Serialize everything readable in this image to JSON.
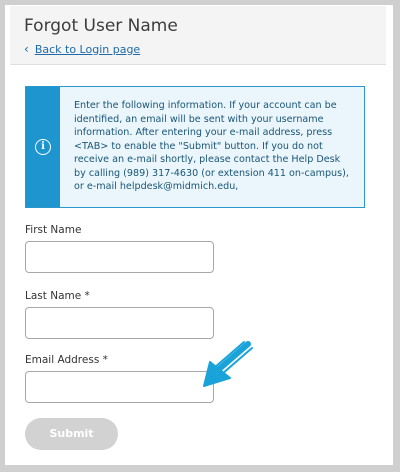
{
  "header": {
    "title": "Forgot User Name",
    "back_link": "Back to Login page"
  },
  "info": {
    "icon": "info-icon",
    "lines": [
      "Enter the following information. If your account can be",
      "identified, an email will be sent with your username",
      "information. After entering your e-mail address, press",
      "<TAB> to enable the \"Submit\" button. If you do not",
      "receive an e-mail shortly, please contact the Help Desk",
      "by calling (989) 317-4630 (or extension 411 on-campus),",
      "or e-mail helpdesk@midmich.edu,"
    ]
  },
  "form": {
    "first_name_label": "First Name",
    "last_name_label": "Last Name *",
    "email_label": "Email Address *",
    "first_name_value": "",
    "last_name_value": "",
    "email_value": "",
    "submit_label": "Submit"
  },
  "colors": {
    "accent": "#1f95cf",
    "annotation_arrow": "#1aa3d8",
    "submit_disabled": "#d2d2d2"
  }
}
